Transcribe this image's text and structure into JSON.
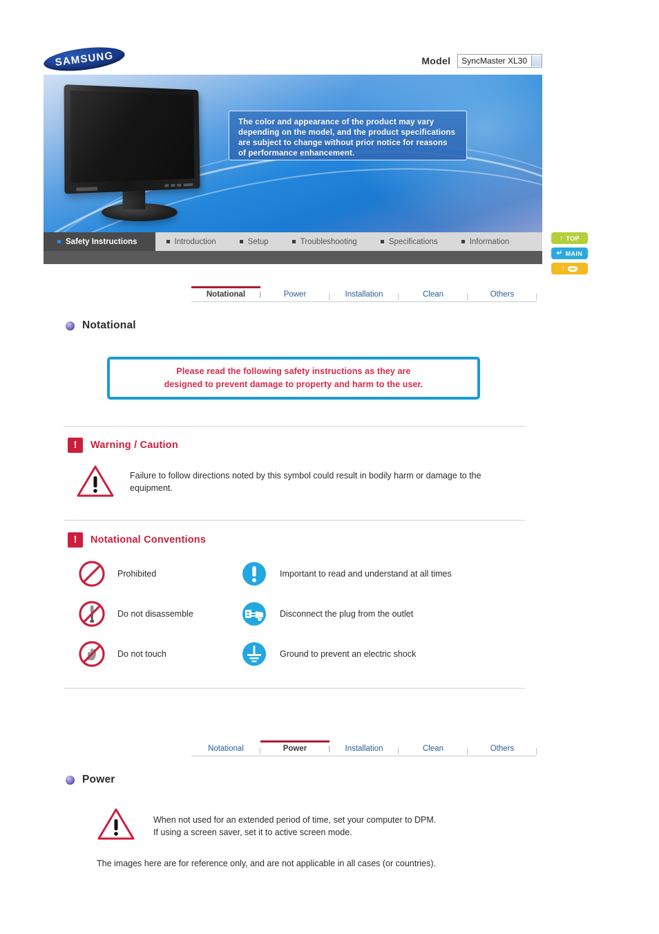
{
  "header": {
    "logo_text": "SAMSUNG",
    "model_label": "Model",
    "model_value": "SyncMaster XL30"
  },
  "banner": {
    "notice": "The color and appearance of the product may vary depending on the model, and the product specifications are subject to change without prior notice for reasons of performance enhancement."
  },
  "main_nav": {
    "tabs": [
      {
        "label": "Safety Instructions",
        "active": true
      },
      {
        "label": "Introduction",
        "active": false
      },
      {
        "label": "Setup",
        "active": false
      },
      {
        "label": "Troubleshooting",
        "active": false
      },
      {
        "label": "Specifications",
        "active": false
      },
      {
        "label": "Information",
        "active": false
      }
    ]
  },
  "side_buttons": [
    {
      "label": "TOP",
      "color": "#b5cf3b"
    },
    {
      "label": "MAIN",
      "color": "#2aa9e0"
    },
    {
      "label": "",
      "color": "#f5b921"
    }
  ],
  "sub_nav_top": {
    "items": [
      {
        "label": "Notational",
        "active": true
      },
      {
        "label": "Power",
        "active": false
      },
      {
        "label": "Installation",
        "active": false
      },
      {
        "label": "Clean",
        "active": false
      },
      {
        "label": "Others",
        "active": false
      }
    ]
  },
  "sub_nav_bottom": {
    "items": [
      {
        "label": "Notational",
        "active": false
      },
      {
        "label": "Power",
        "active": true
      },
      {
        "label": "Installation",
        "active": false
      },
      {
        "label": "Clean",
        "active": false
      },
      {
        "label": "Others",
        "active": false
      }
    ]
  },
  "notational_section": {
    "heading": "Notational",
    "notice_line1": "Please read the following safety instructions as they are",
    "notice_line2": "designed to prevent damage to property and harm to the user.",
    "warning_heading": "Warning / Caution",
    "warning_text": "Failure to follow directions noted by this symbol could result in bodily harm or damage to the equipment.",
    "conventions_heading": "Notational Conventions",
    "conventions": [
      {
        "icon": "prohibited-icon",
        "label": "Prohibited"
      },
      {
        "icon": "important-icon",
        "label": "Important to read and understand at all times"
      },
      {
        "icon": "do-not-disassemble-icon",
        "label": "Do not disassemble"
      },
      {
        "icon": "disconnect-plug-icon",
        "label": "Disconnect the plug from the outlet"
      },
      {
        "icon": "do-not-touch-icon",
        "label": "Do not touch"
      },
      {
        "icon": "ground-icon",
        "label": "Ground to prevent an electric shock"
      }
    ]
  },
  "power_section": {
    "heading": "Power",
    "warning_line1": "When not used for an extended period of time, set your computer to DPM.",
    "warning_line2": "If using a screen saver, set it to active screen mode.",
    "footnote": "The images here are for reference only, and are not applicable in all cases (or countries)."
  },
  "colors": {
    "accent_red": "#cc1f3d",
    "accent_blue": "#1b9ad6",
    "nav_active": "#4a4a4a",
    "link_blue": "#2a5c9a",
    "bullet_purple": "#6f63c4"
  }
}
